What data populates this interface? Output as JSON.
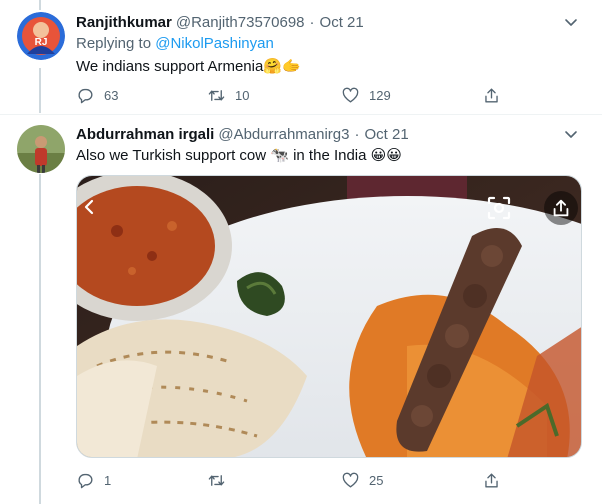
{
  "tweets": [
    {
      "name": "Ranjithkumar",
      "handle": "@Ranjith73570698",
      "separator": "·",
      "date": "Oct 21",
      "replying_prefix": "Replying to ",
      "replying_to": "@NikolPashinyan",
      "text": "We indians support Armenia🤗🫱",
      "replies": "63",
      "retweets": "10",
      "likes": "129"
    },
    {
      "name": "Abdurrahman irgali",
      "handle": "@Abdurrahmanirg3",
      "separator": "·",
      "date": "Oct 21",
      "text": "Also we Turkish support cow 🐄 in the India 😀😀",
      "replies": "1",
      "retweets": "",
      "likes": "25"
    }
  ],
  "icons": {
    "caret": "chevron-down-icon",
    "reply": "reply-icon",
    "retweet": "retweet-icon",
    "like": "heart-icon",
    "share": "share-icon",
    "media_close": "close-icon",
    "media_lens": "lens-icon",
    "media_share": "share-icon"
  },
  "colors": {
    "text_primary": "#0f1419",
    "text_secondary": "#536471",
    "link": "#1d9bf0",
    "thread_line": "#cfd9de"
  }
}
